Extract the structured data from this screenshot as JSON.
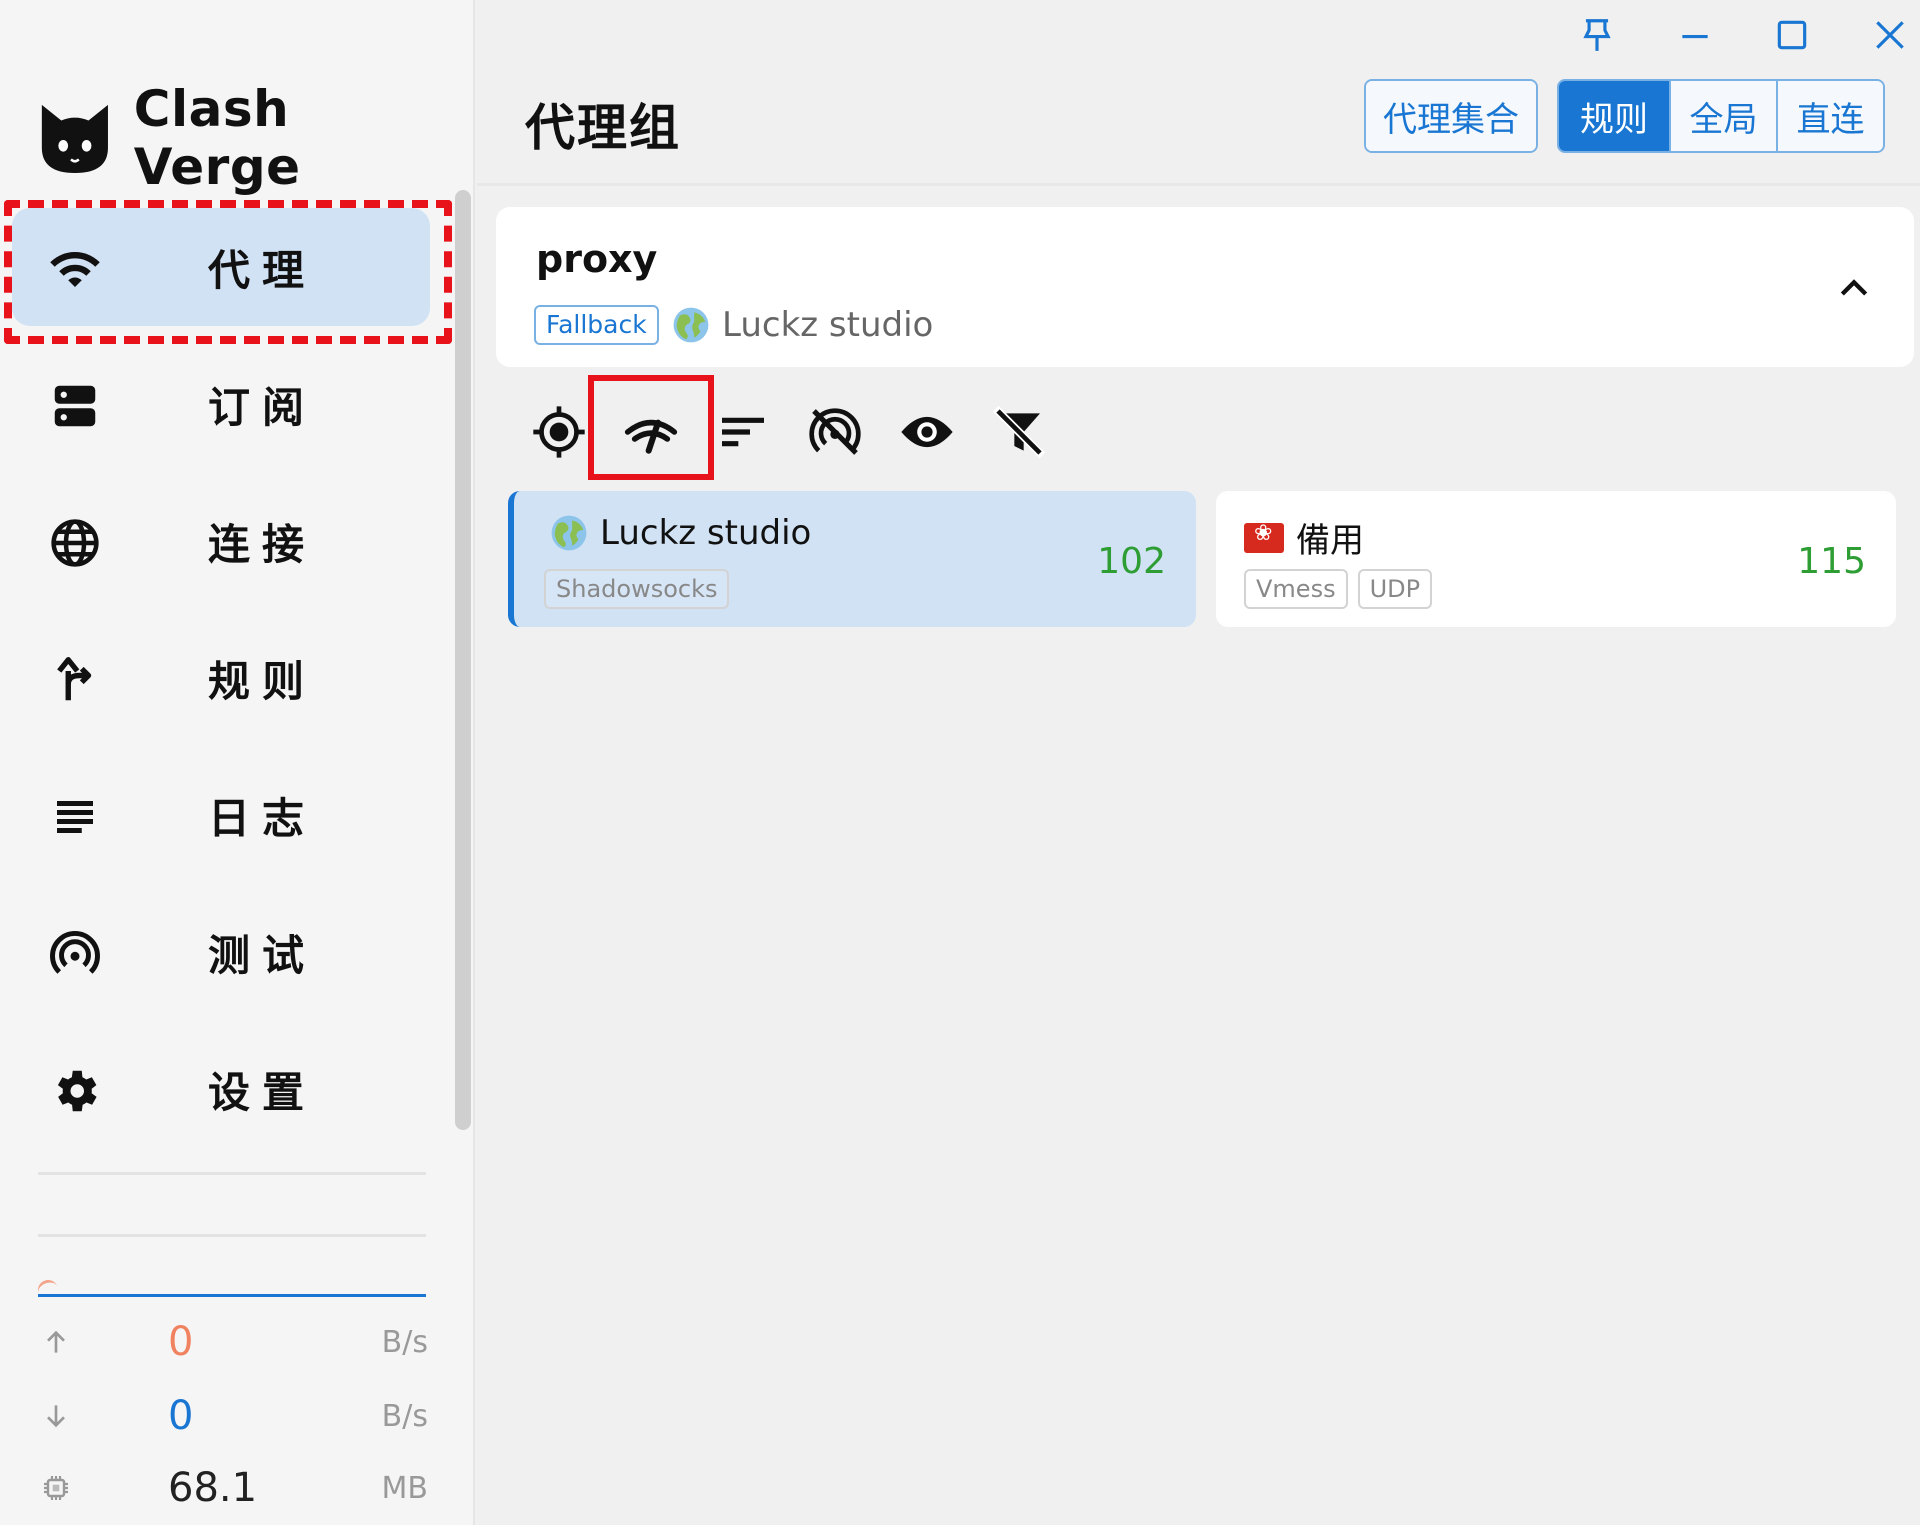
{
  "app": {
    "name": "Clash Verge"
  },
  "sidebar": {
    "items": [
      {
        "label": "代理",
        "icon": "wifi-icon",
        "active": true
      },
      {
        "label": "订阅",
        "icon": "storage-icon",
        "active": false
      },
      {
        "label": "连接",
        "icon": "globe-icon",
        "active": false
      },
      {
        "label": "规则",
        "icon": "fork-icon",
        "active": false
      },
      {
        "label": "日志",
        "icon": "list-icon",
        "active": false
      },
      {
        "label": "测试",
        "icon": "radar-icon",
        "active": false
      },
      {
        "label": "设置",
        "icon": "gear-icon",
        "active": false
      }
    ],
    "traffic": {
      "upload": {
        "value": "0",
        "unit": "B/s"
      },
      "download": {
        "value": "0",
        "unit": "B/s"
      },
      "memory": {
        "value": "68.1",
        "unit": "MB"
      }
    }
  },
  "header": {
    "title": "代理组",
    "proxy_set_label": "代理集合",
    "modes": [
      {
        "label": "规则",
        "active": true
      },
      {
        "label": "全局",
        "active": false
      },
      {
        "label": "直连",
        "active": false
      }
    ]
  },
  "group": {
    "name": "proxy",
    "type": "Fallback",
    "current": "Luckz studio"
  },
  "tools": [
    "locate-icon",
    "speed-test-icon",
    "sort-icon",
    "hide-unavailable-icon",
    "eye-icon",
    "filter-off-icon"
  ],
  "proxies": [
    {
      "name": "Luckz studio",
      "tags": [
        "Shadowsocks"
      ],
      "delay": "102",
      "selected": true
    },
    {
      "name": "備用",
      "tags": [
        "Vmess",
        "UDP"
      ],
      "delay": "115",
      "selected": false
    }
  ],
  "colors": {
    "accent": "#1976d2",
    "active_bg": "#d1e2f5",
    "highlight": "#e8131a",
    "delay_good": "#2e9e34",
    "upload": "#f0825f"
  }
}
